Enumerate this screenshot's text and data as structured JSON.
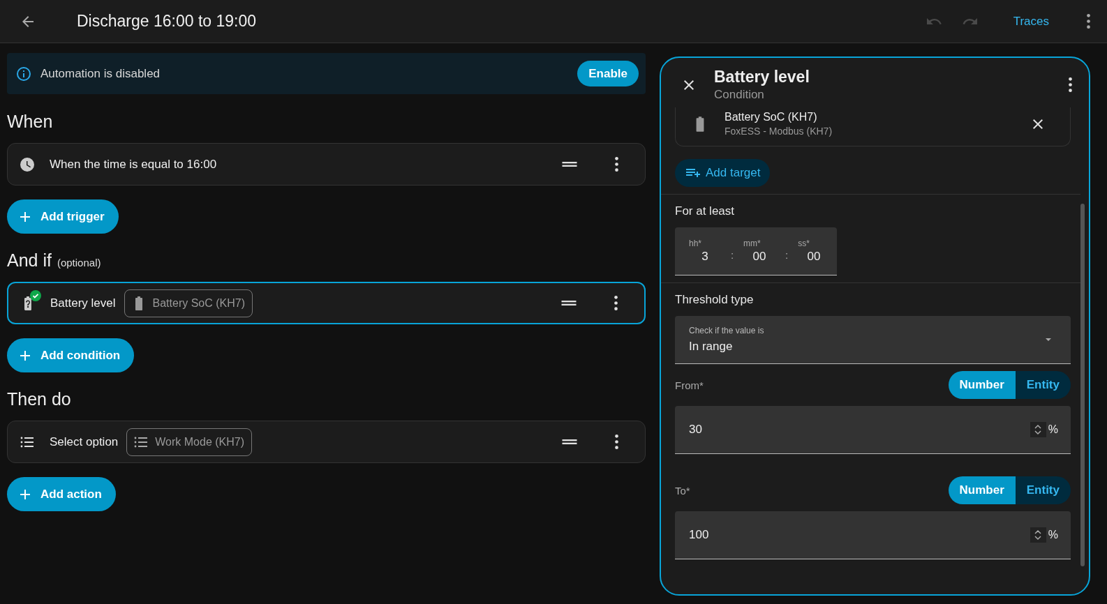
{
  "header": {
    "title": "Discharge 16:00 to 19:00",
    "undo": {
      "disabled": true
    },
    "redo": {
      "disabled": true
    },
    "traces": "Traces"
  },
  "banner": {
    "message": "Automation is disabled",
    "button": "Enable"
  },
  "sections": [
    {
      "title": "When",
      "items": [
        {
          "kind": "clock",
          "text": "When the time is equal to 16:00",
          "selected": false
        }
      ],
      "add_button": "Add trigger"
    },
    {
      "title": "And if",
      "hint": "(optional)",
      "items": [
        {
          "kind": "battery",
          "text": "Battery level",
          "valid": true,
          "chip": {
            "kind": "battery",
            "text": "Battery SoC (KH7)"
          },
          "selected": true
        }
      ],
      "add_button": "Add condition"
    },
    {
      "title": "Then do",
      "items": [
        {
          "kind": "list",
          "text": "Select option",
          "chip": {
            "kind": "list",
            "text": "Work Mode (KH7)"
          },
          "selected": false
        }
      ],
      "add_button": "Add action"
    }
  ],
  "panel": {
    "title": "Battery level",
    "subtitle": "Condition",
    "target": {
      "name": "Battery SoC (KH7)",
      "device": "FoxESS - Modbus (KH7)"
    },
    "add_target": "Add target",
    "duration": {
      "label": "For at least",
      "separator": ":",
      "fields": [
        {
          "label": "hh*",
          "value": "3"
        },
        {
          "label": "mm*",
          "value": "00"
        },
        {
          "label": "ss*",
          "value": "00"
        }
      ]
    },
    "threshold": {
      "label": "Threshold type",
      "select": {
        "label": "Check if the value is",
        "value": "In range"
      }
    },
    "limits": [
      {
        "label": "From*",
        "modes": [
          {
            "label": "Number",
            "selected": true
          },
          {
            "label": "Entity",
            "selected": false
          }
        ],
        "value": "30",
        "unit": "%"
      },
      {
        "label": "To*",
        "modes": [
          {
            "label": "Number",
            "selected": true
          },
          {
            "label": "Entity",
            "selected": false
          }
        ],
        "value": "100",
        "unit": "%"
      }
    ]
  }
}
